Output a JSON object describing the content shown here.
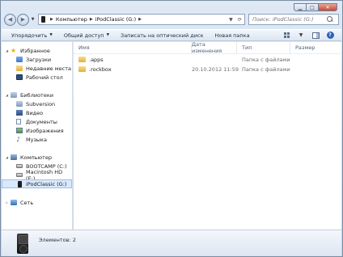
{
  "window": {
    "caption": {
      "minimize": "▁",
      "maximize": "□",
      "close": "✕"
    }
  },
  "address": {
    "breadcrumbs": [
      "Компьютер",
      "iPodClassic (G:)"
    ],
    "search_placeholder": "Поиск: iPodClassic (G:)"
  },
  "toolbar": {
    "organize": "Упорядочить",
    "share": "Общий доступ",
    "burn": "Записать на оптический диск",
    "new_folder": "Новая папка"
  },
  "nav": {
    "favorites": {
      "label": "Избранное",
      "items": [
        "Загрузки",
        "Недавние места",
        "Рабочий стол"
      ]
    },
    "libraries": {
      "label": "Библиотеки",
      "items": [
        "Subversion",
        "Видео",
        "Документы",
        "Изображения",
        "Музыка"
      ]
    },
    "computer": {
      "label": "Компьютер",
      "items": [
        "BOOTCAMP (C:)",
        "Macintosh HD (E:)",
        "iPodClassic (G:)"
      ]
    },
    "network": {
      "label": "Сеть"
    }
  },
  "files": {
    "columns": {
      "name": "Имя",
      "date": "Дата изменения",
      "type": "Тип",
      "size": "Размер"
    },
    "rows": [
      {
        "name": ".apps",
        "date": "",
        "type": "Папка с файлами",
        "size": ""
      },
      {
        "name": ".rockbox",
        "date": "20.10.2012 11:59",
        "type": "Папка с файлами",
        "size": ""
      }
    ]
  },
  "details": {
    "items_count": "Элементов: 2"
  }
}
